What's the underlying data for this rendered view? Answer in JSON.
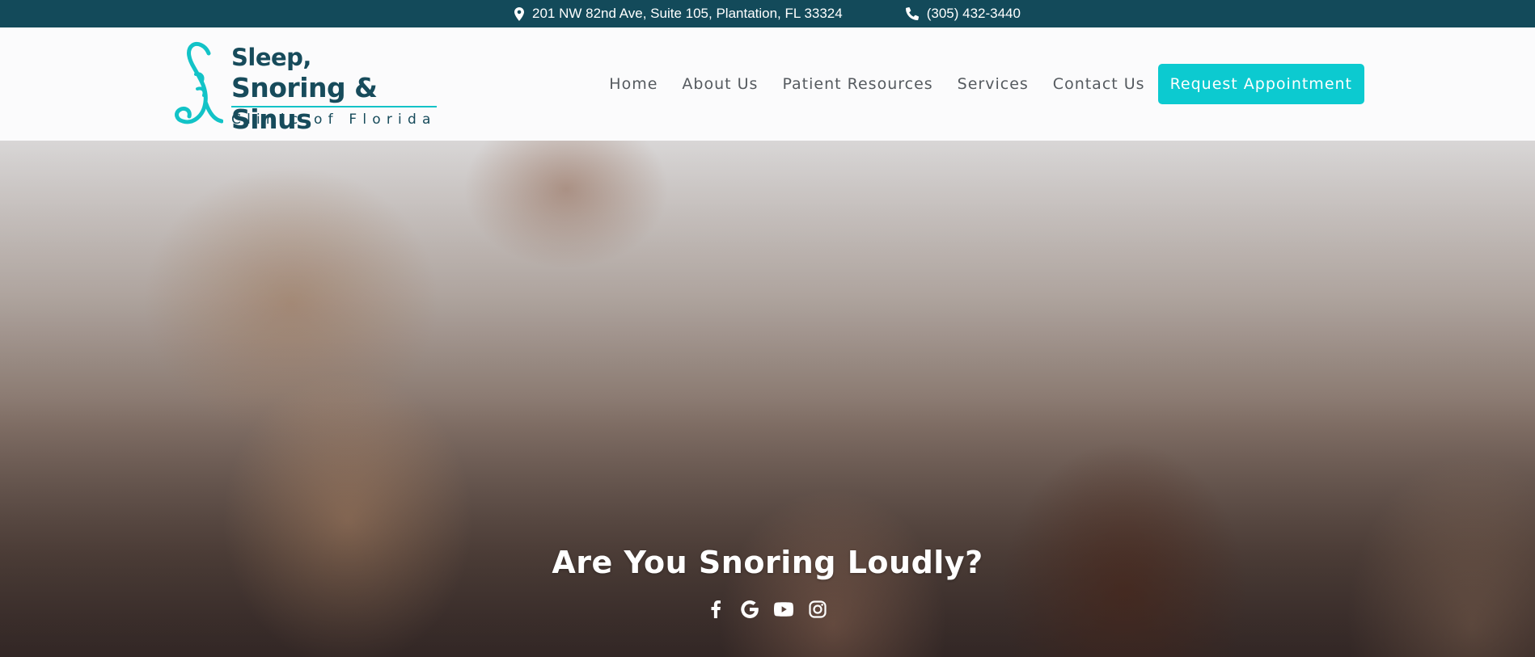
{
  "topbar": {
    "address": "201 NW 82nd Ave, Suite 105, Plantation, FL 33324",
    "phone": "(305) 432-3440",
    "address_icon": "map-pin-icon",
    "phone_icon": "phone-icon"
  },
  "logo": {
    "line1": "Sleep,",
    "line2": "Snoring & Sinus",
    "subtitle": "Clinic of Florida"
  },
  "nav": {
    "items": [
      {
        "label": "Home"
      },
      {
        "label": "About Us"
      },
      {
        "label": "Patient Resources"
      },
      {
        "label": "Services"
      },
      {
        "label": "Contact Us"
      }
    ],
    "cta_label": "Request Appointment"
  },
  "hero": {
    "title": "Are You Snoring Loudly?",
    "social_icons": [
      "facebook-icon",
      "google-icon",
      "youtube-icon",
      "instagram-icon"
    ]
  },
  "colors": {
    "topbar_bg": "#134a5a",
    "brand_dark": "#174b5b",
    "accent": "#0ccad0",
    "nav_text": "#555a5f"
  }
}
